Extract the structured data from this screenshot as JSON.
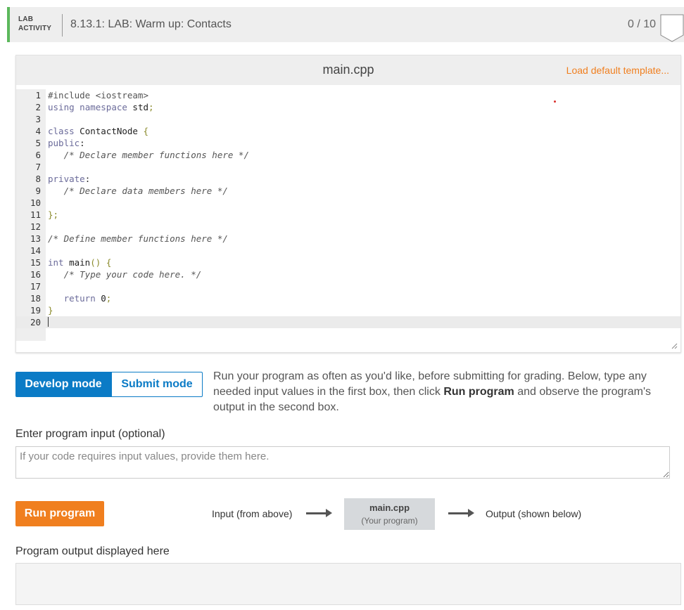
{
  "header": {
    "tag_line1": "LAB",
    "tag_line2": "ACTIVITY",
    "title": "8.13.1: LAB: Warm up: Contacts",
    "score": "0 / 10",
    "accent_color": "#5cb85c"
  },
  "editor": {
    "file_name": "main.cpp",
    "load_template_label": "Load default template...",
    "lines": [
      "#include <iostream>",
      "using namespace std;",
      "",
      "class ContactNode {",
      "public:",
      "   /* Declare member functions here */",
      "",
      "private:",
      "   /* Declare data members here */",
      "",
      "};",
      "",
      "/* Define member functions here */",
      "",
      "int main() {",
      "   /* Type your code here. */",
      "",
      "   return 0;",
      "}",
      ""
    ],
    "active_line": 20
  },
  "modes": {
    "develop_label": "Develop mode",
    "submit_label": "Submit mode",
    "active": "develop",
    "desc_part1": "Run your program as often as you'd like, before submitting for grading. Below, type any needed input values in the first box, then click ",
    "desc_bold": "Run program",
    "desc_part2": " and observe the program's output in the second box."
  },
  "input": {
    "label": "Enter program input (optional)",
    "placeholder": "If your code requires input values, provide them here.",
    "value": ""
  },
  "run": {
    "button_label": "Run program",
    "input_flow_label": "Input (from above)",
    "program_name": "main.cpp",
    "program_sub": "(Your program)",
    "output_flow_label": "Output (shown below)"
  },
  "output": {
    "label": "Program output displayed here",
    "value": ""
  },
  "colors": {
    "primary_blue": "#0b7bc6",
    "run_orange": "#f07f1f"
  }
}
